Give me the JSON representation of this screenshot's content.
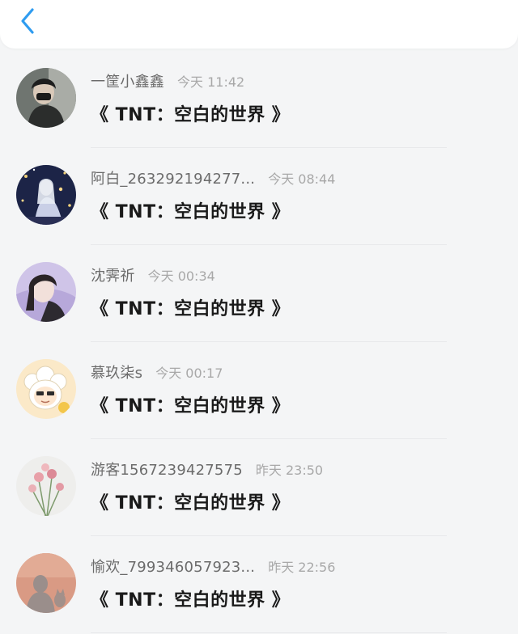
{
  "header": {
    "back_icon": "chevron-left-icon",
    "accent_color": "#2f9cf0"
  },
  "comments": [
    {
      "username": "一筐小鑫鑫",
      "time": "今天 11:42",
      "text": "《 TNT：空白的世界 》"
    },
    {
      "username": "阿白_263292194277...",
      "time": "今天 08:44",
      "text": "《 TNT：空白的世界 》"
    },
    {
      "username": "沈霁祈",
      "time": "今天 00:34",
      "text": "《 TNT：空白的世界 》"
    },
    {
      "username": "慕玖柒s",
      "time": "今天 00:17",
      "text": "《 TNT：空白的世界 》"
    },
    {
      "username": "游客1567239427575",
      "time": "昨天 23:50",
      "text": "《 TNT：空白的世界 》"
    },
    {
      "username": "愉欢_799346057923...",
      "time": "昨天 22:56",
      "text": "《 TNT：空白的世界 》"
    }
  ]
}
